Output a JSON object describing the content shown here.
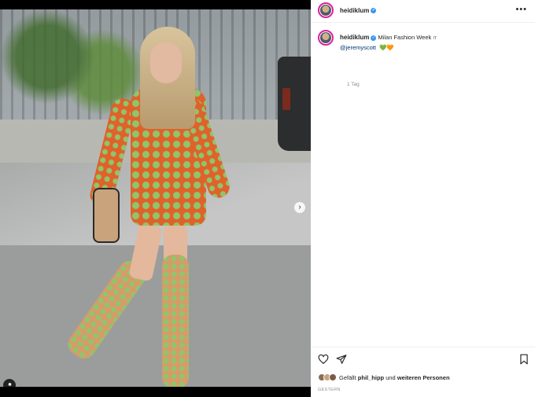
{
  "post": {
    "author": "heidiklum",
    "caption_location": "Milan Fashion Week",
    "caption_flag": "IT",
    "mention": "@jeremyscott",
    "hearts": [
      "💚",
      "🧡"
    ],
    "time_ago": "1 Tag"
  },
  "header": {
    "more_label": "•••"
  },
  "media": {
    "next_label": "›",
    "slide_count": 2,
    "active_slide": 1
  },
  "likes": {
    "prefix": "Gefällt",
    "first_user": "phil_hipp",
    "connector": "und",
    "others": "weiteren Personen"
  },
  "date_label": "GESTERN",
  "colors": {
    "verified": "#3897f0",
    "story_ring": "#d6249f",
    "link": "#00376b"
  }
}
